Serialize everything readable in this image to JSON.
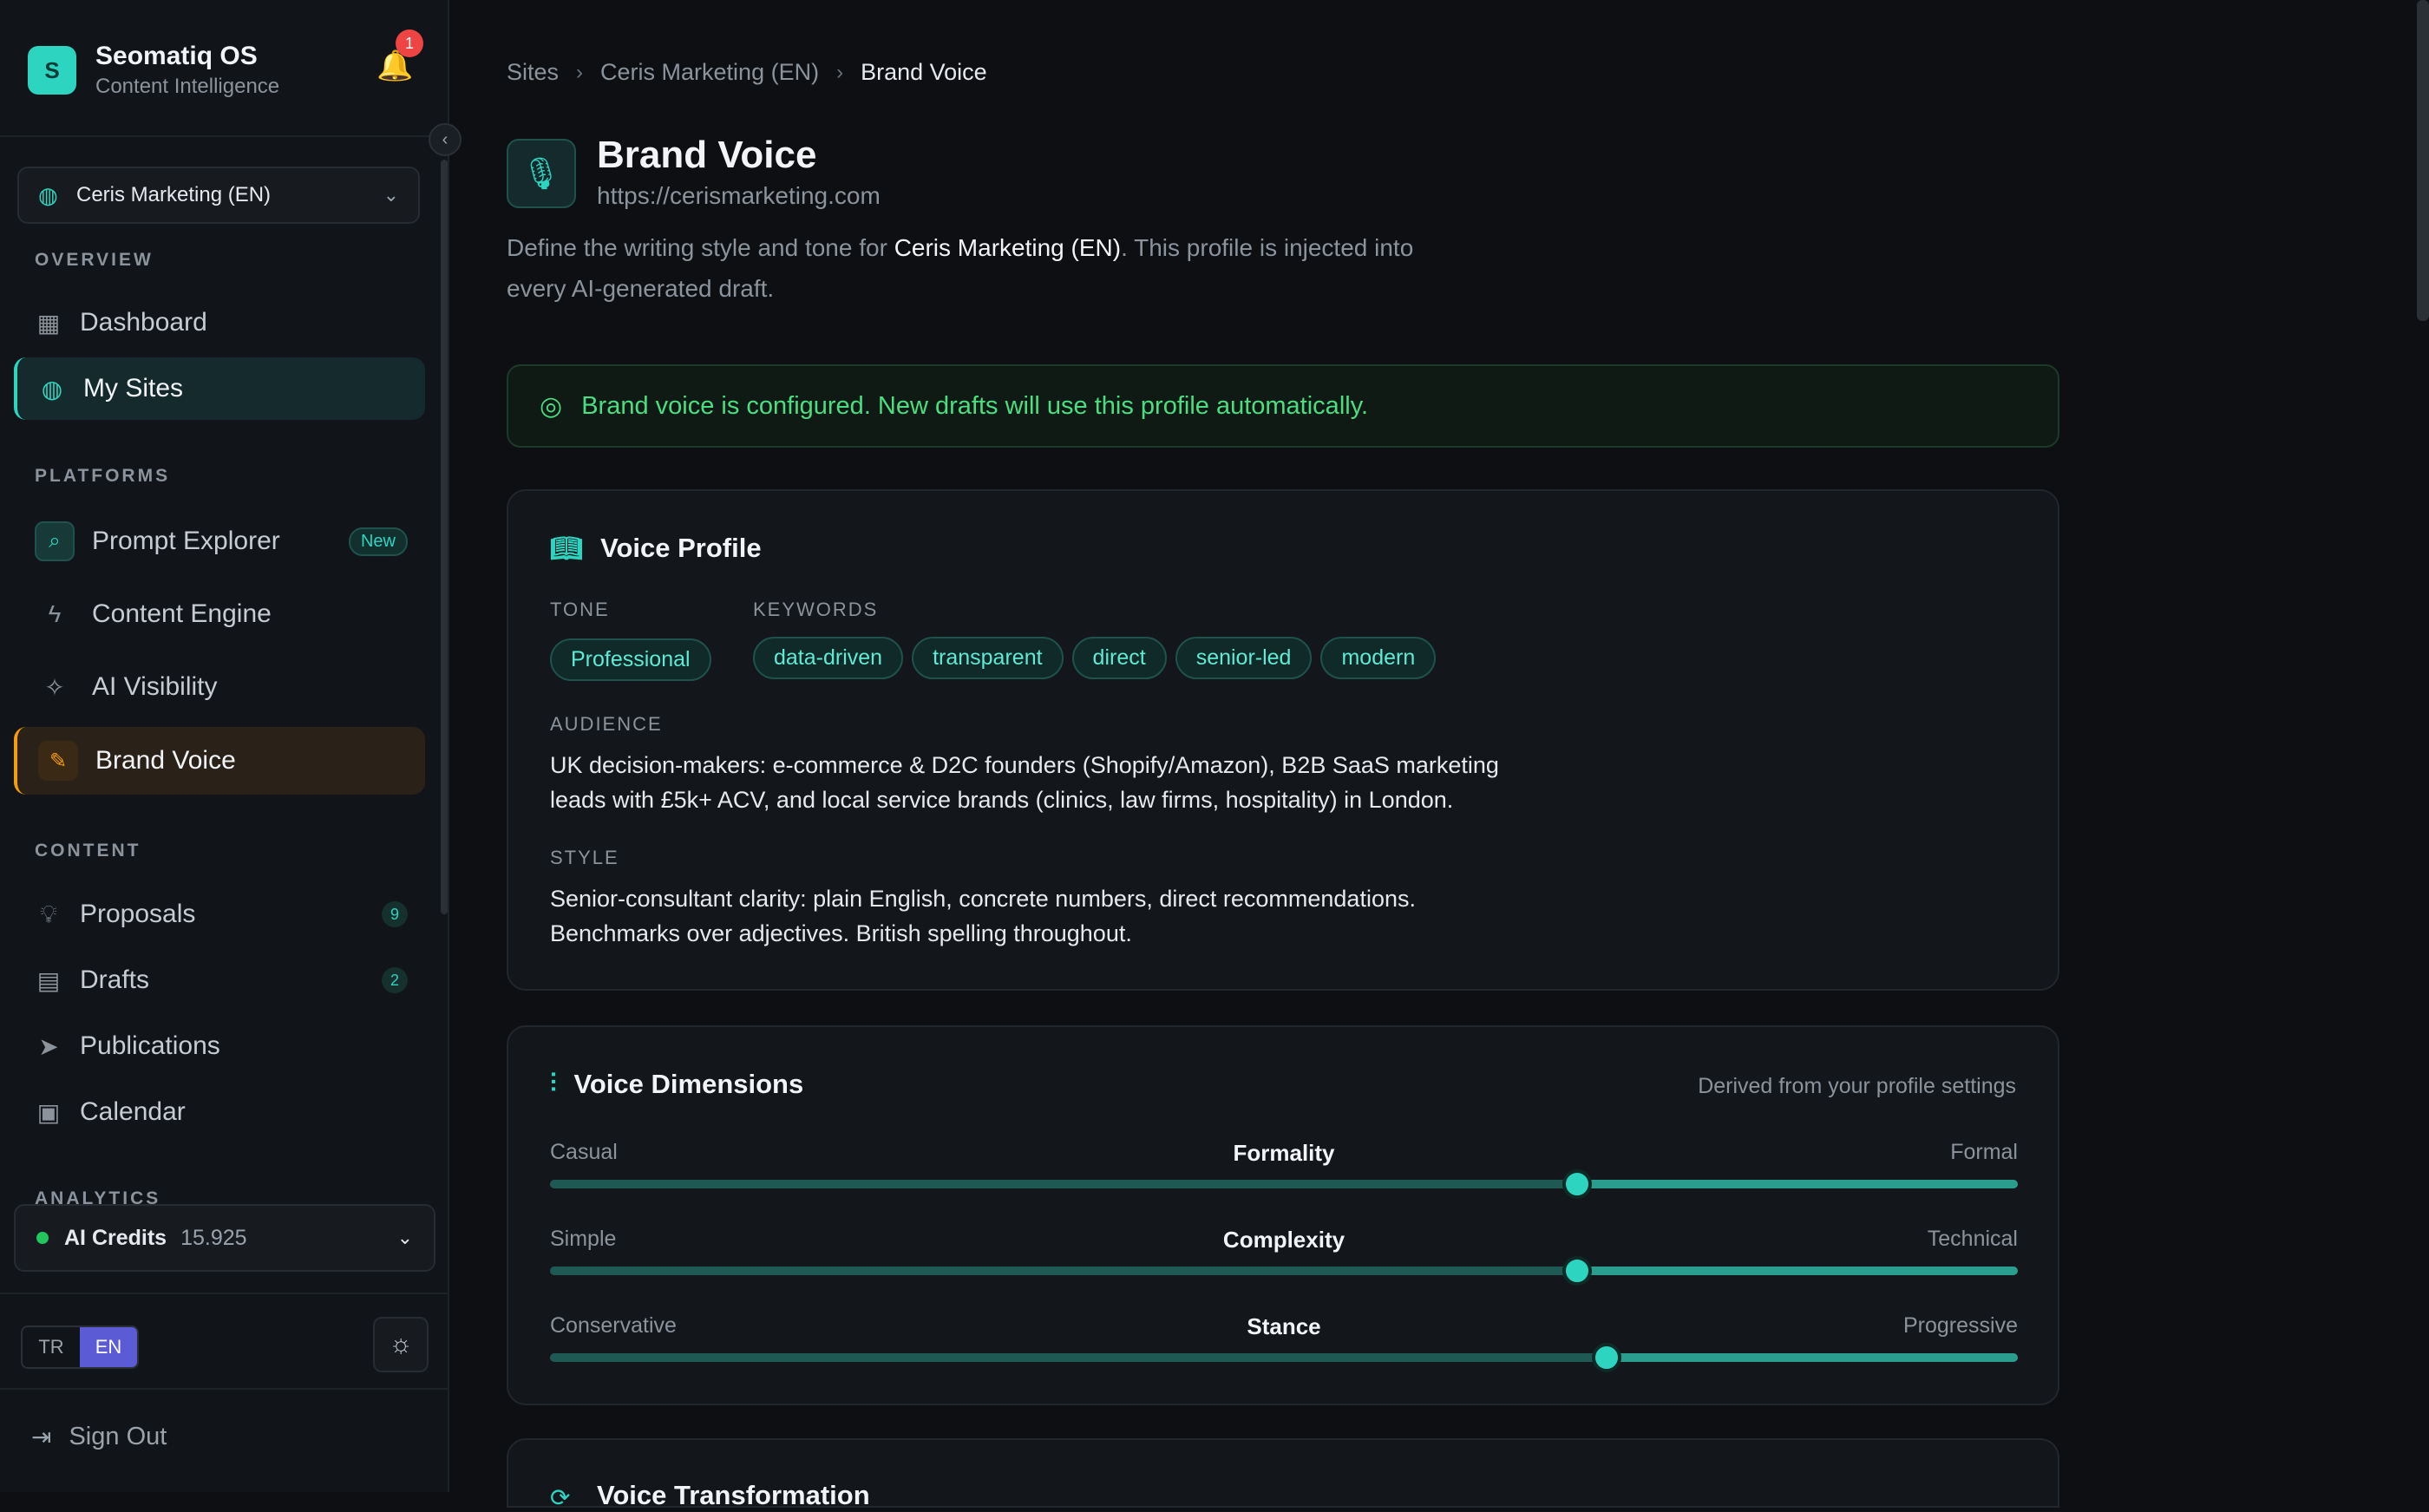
{
  "app": {
    "title": "Seomatiq OS",
    "subtitle": "Content Intelligence",
    "logo_letter": "S",
    "notification_count": "1"
  },
  "sidebar": {
    "site_selector": "Ceris Marketing (EN)",
    "sections": {
      "overview": "OVERVIEW",
      "platforms": "PLATFORMS",
      "content": "CONTENT",
      "analytics": "ANALYTICS"
    },
    "overview_items": [
      {
        "label": "Dashboard",
        "icon": "grid-icon"
      },
      {
        "label": "My Sites",
        "icon": "globe-icon",
        "active": true
      }
    ],
    "platform_items": [
      {
        "label": "Prompt Explorer",
        "icon": "search-sparkle-icon",
        "badge": "New"
      },
      {
        "label": "Content Engine",
        "icon": "lightning-icon"
      },
      {
        "label": "AI Visibility",
        "icon": "sparkles-icon"
      },
      {
        "label": "Brand Voice",
        "icon": "pen-icon",
        "active": true
      }
    ],
    "content_items": [
      {
        "label": "Proposals",
        "icon": "lightbulb-icon",
        "count": "9"
      },
      {
        "label": "Drafts",
        "icon": "document-icon",
        "count": "2"
      },
      {
        "label": "Publications",
        "icon": "send-icon"
      },
      {
        "label": "Calendar",
        "icon": "calendar-icon"
      }
    ],
    "credits": {
      "label": "AI Credits",
      "value": "15.925"
    },
    "languages": [
      "TR",
      "EN"
    ],
    "active_language": "EN",
    "sign_out": "Sign Out"
  },
  "breadcrumb": [
    "Sites",
    "Ceris Marketing (EN)",
    "Brand Voice"
  ],
  "header": {
    "title": "Brand Voice",
    "url": "https://cerismarketing.com",
    "desc_before": "Define the writing style and tone for ",
    "desc_site": "Ceris Marketing (EN)",
    "desc_after": ". This profile is injected into every AI-generated draft."
  },
  "alert": {
    "text": "Brand voice is configured. New drafts will use this profile automatically.",
    "color": "#4ade80"
  },
  "voice_profile": {
    "title": "Voice Profile",
    "tone_label": "TONE",
    "tone": "Professional",
    "keywords_label": "KEYWORDS",
    "keywords": [
      "data-driven",
      "transparent",
      "direct",
      "senior-led",
      "modern"
    ],
    "audience_label": "AUDIENCE",
    "audience": "UK decision-makers: e-commerce & D2C founders (Shopify/Amazon), B2B SaaS marketing leads with £5k+ ACV, and local service brands (clinics, law firms, hospitality) in London.",
    "style_label": "STYLE",
    "style": "Senior-consultant clarity: plain English, concrete numbers, direct recommendations. Benchmarks over adjectives. British spelling throughout."
  },
  "voice_dimensions": {
    "title": "Voice Dimensions",
    "note": "Derived from your profile settings",
    "sliders": [
      {
        "name": "Formality",
        "left": "Casual",
        "right": "Formal",
        "value": 0.7
      },
      {
        "name": "Complexity",
        "left": "Simple",
        "right": "Technical",
        "value": 0.7
      },
      {
        "name": "Stance",
        "left": "Conservative",
        "right": "Progressive",
        "value": 0.72
      }
    ]
  },
  "next_card": {
    "title": "Voice Transformation"
  },
  "colors": {
    "accent": "#2dd4bf",
    "amber": "#f59e0b",
    "background": "#0d0f12"
  }
}
